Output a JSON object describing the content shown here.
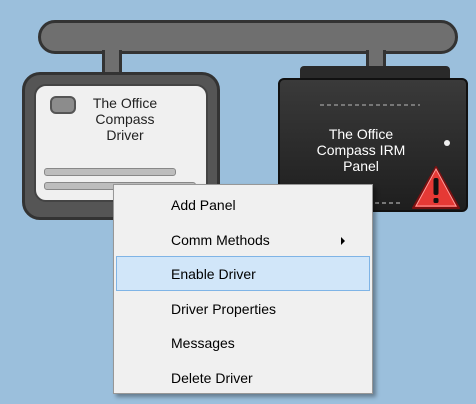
{
  "driver": {
    "label_line1": "The Office",
    "label_line2": "Compass",
    "label_line3": "Driver"
  },
  "irm_panel": {
    "label_line1": "The Office",
    "label_line2": "Compass IRM",
    "label_line3": "Panel",
    "warning_icon": "warning-triangle-icon",
    "warning_color": "#e53935"
  },
  "context_menu": {
    "items": [
      {
        "label": "Add Panel"
      },
      {
        "label": "Comm Methods"
      },
      {
        "label": "Enable Driver"
      },
      {
        "label": "Driver Properties"
      },
      {
        "label": "Messages"
      },
      {
        "label": "Delete Driver"
      }
    ],
    "highlight_color": "#d1e6f9"
  },
  "colors": {
    "background": "#9bbfdc",
    "bus": "#6f6f6f"
  }
}
